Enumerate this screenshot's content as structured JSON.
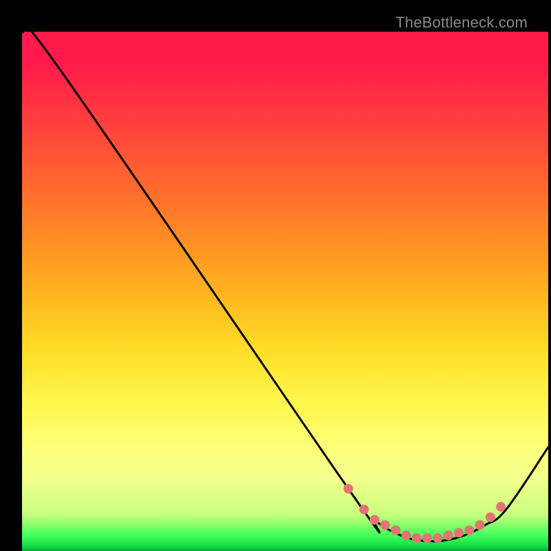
{
  "watermark": "TheBottleneck.com",
  "colors": {
    "line": "#000000",
    "marker": "#e57373",
    "background": "#000000"
  },
  "chart_data": {
    "type": "line",
    "title": "",
    "xlabel": "",
    "ylabel": "",
    "xlim": [
      0,
      100
    ],
    "ylim": [
      0,
      100
    ],
    "series": [
      {
        "name": "curve",
        "x": [
          0,
          7,
          62,
          67,
          72,
          76,
          80,
          84,
          88,
          92,
          100
        ],
        "y": [
          100,
          93,
          12,
          6,
          3,
          2,
          2,
          3,
          5,
          8,
          20
        ]
      }
    ],
    "markers": {
      "name": "highlight-points",
      "x": [
        62,
        65,
        67,
        69,
        71,
        73,
        75,
        77,
        79,
        81,
        83,
        85,
        87,
        89,
        91
      ],
      "y": [
        12,
        8,
        6,
        5,
        4,
        3,
        2.5,
        2.5,
        2.5,
        3,
        3.5,
        4,
        5,
        6.5,
        8.5
      ]
    }
  }
}
